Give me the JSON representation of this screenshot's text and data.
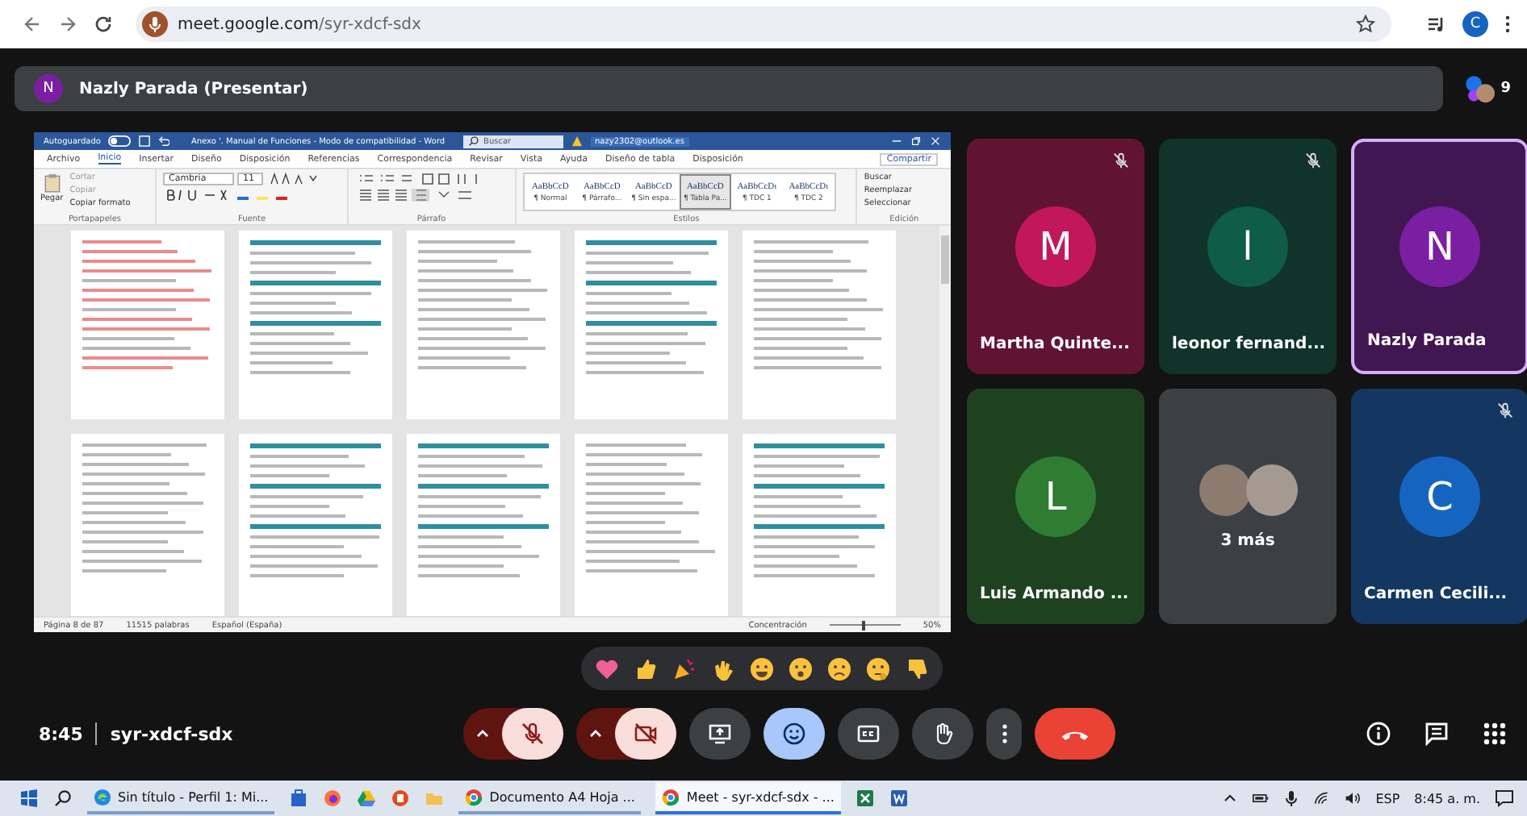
{
  "browser": {
    "url_host": "meet.google.com",
    "url_path": "/syr-xdcf-sdx",
    "profile_initial": "C"
  },
  "presenter_bar": {
    "initial": "N",
    "color": "#7b1fa2",
    "label": "Nazly Parada (Presentar)",
    "participant_count": "9"
  },
  "shared_screen": {
    "autosave": "Autoguardado",
    "title": "Anexo '. Manual de Funciones - Modo de compatibilidad - Word",
    "search": "Buscar",
    "account": "nazy2302@outlook.es",
    "tabs": [
      {
        "label": "Archivo",
        "selected": false
      },
      {
        "label": "Inicio",
        "selected": true
      },
      {
        "label": "Insertar",
        "selected": false
      },
      {
        "label": "Diseño",
        "selected": false
      },
      {
        "label": "Disposición",
        "selected": false
      },
      {
        "label": "Referencias",
        "selected": false
      },
      {
        "label": "Correspondencia",
        "selected": false
      },
      {
        "label": "Revisar",
        "selected": false
      },
      {
        "label": "Vista",
        "selected": false
      },
      {
        "label": "Ayuda",
        "selected": false
      },
      {
        "label": "Diseño de tabla",
        "selected": false
      },
      {
        "label": "Disposición",
        "selected": false
      }
    ],
    "share": "Compartir",
    "clipboard": {
      "paste": "Pegar",
      "cut": "Cortar",
      "copy": "Copiar",
      "format_painter": "Copiar formato",
      "group": "Portapapeles"
    },
    "font": {
      "name": "Cambria",
      "size": "11",
      "group": "Fuente"
    },
    "paragraph": {
      "group": "Párrafo"
    },
    "styles": {
      "group": "Estilos",
      "items": [
        {
          "sample": "AaBbCcD",
          "name": "¶ Normal",
          "selected": false
        },
        {
          "sample": "AaBbCcD",
          "name": "¶ Párrafo...",
          "selected": false
        },
        {
          "sample": "AaBbCcD",
          "name": "¶ Sin espa...",
          "selected": false
        },
        {
          "sample": "AaBbCcD",
          "name": "¶ Tabla Pa...",
          "selected": true
        },
        {
          "sample": "AaBbCcDı",
          "name": "¶ TDC 1",
          "selected": false
        },
        {
          "sample": "AaBbCcDı",
          "name": "¶ TDC 2",
          "selected": false
        }
      ]
    },
    "editing": {
      "group": "Edición",
      "find": "Buscar",
      "replace": "Reemplazar",
      "select": "Seleccionar"
    },
    "pages": [
      {
        "kind": "red"
      },
      {
        "kind": "table"
      },
      {
        "kind": "text"
      },
      {
        "kind": "table"
      },
      {
        "kind": "text"
      },
      {
        "kind": "text"
      },
      {
        "kind": "table"
      },
      {
        "kind": "table"
      },
      {
        "kind": "text"
      },
      {
        "kind": "table"
      }
    ],
    "status": {
      "page": "Página 8 de 87",
      "words": "11515 palabras",
      "language": "Español (España)",
      "focus": "Concentración",
      "zoom": "50%",
      "zoom_slider": {
        "level": 0.45
      }
    }
  },
  "tiles": [
    {
      "kind": "person",
      "initial": "M",
      "name": "Martha Quinte...",
      "color": "#c2185b",
      "muted": true,
      "speaking": false
    },
    {
      "kind": "person",
      "initial": "l",
      "name": "leonor fernand...",
      "color": "#0f5c48",
      "muted": true,
      "speaking": false
    },
    {
      "kind": "person",
      "initial": "N",
      "name": "Nazly Parada",
      "color": "#7b1fa2",
      "muted": false,
      "speaking": true
    },
    {
      "kind": "person",
      "initial": "L",
      "name": "Luis Armando ...",
      "color": "#2e7d32",
      "muted": false,
      "speaking": false
    },
    {
      "kind": "overflow",
      "label": "3 más"
    },
    {
      "kind": "person",
      "initial": "C",
      "name": "Carmen Cecili...",
      "color": "#1565c0",
      "muted": true,
      "speaking": false
    }
  ],
  "reactions": [
    {
      "kind": "heart"
    },
    {
      "kind": "thumbs-up"
    },
    {
      "kind": "party"
    },
    {
      "kind": "clap"
    },
    {
      "kind": "laugh"
    },
    {
      "kind": "surprised"
    },
    {
      "kind": "sad"
    },
    {
      "kind": "thinking"
    },
    {
      "kind": "thumbs-down"
    }
  ],
  "meeting": {
    "time": "8:45",
    "code": "syr-xdcf-sdx"
  },
  "controls": [
    {
      "kind": "mic",
      "on": false
    },
    {
      "kind": "camera",
      "on": false
    },
    {
      "kind": "present"
    },
    {
      "kind": "emoji",
      "on": true
    },
    {
      "kind": "captions",
      "on": false
    },
    {
      "kind": "hand",
      "on": false
    },
    {
      "kind": "more"
    },
    {
      "kind": "leave"
    }
  ],
  "taskbar": {
    "apps": [
      {
        "kind": "window",
        "label": "Sin título - Perfil 1: Mi...",
        "selected": false
      },
      {
        "kind": "icon"
      },
      {
        "kind": "icon"
      },
      {
        "kind": "icon"
      },
      {
        "kind": "icon"
      },
      {
        "kind": "icon"
      },
      {
        "kind": "window",
        "label": "Documento A4 Hoja ...",
        "selected": false
      },
      {
        "kind": "window",
        "label": "Meet - syr-xdcf-sdx - ...",
        "selected": true
      },
      {
        "kind": "icon"
      },
      {
        "kind": "icon"
      }
    ],
    "language": "ESP",
    "time": "8:45 a. m."
  }
}
